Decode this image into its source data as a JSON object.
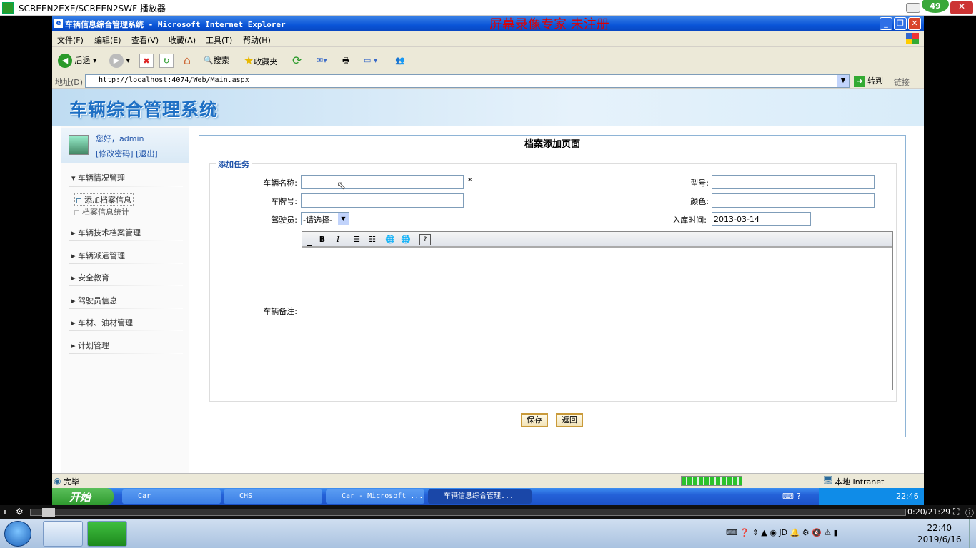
{
  "player": {
    "title": "SCREEN2EXE/SCREEN2SWF 播放器",
    "badge": "49",
    "time": "0:20/21:29"
  },
  "ie": {
    "title": "车辆信息综合管理系统 - Microsoft Internet Explorer",
    "watermark": "屏幕录像专家  未注册",
    "menu": [
      "文件(F)",
      "编辑(E)",
      "查看(V)",
      "收藏(A)",
      "工具(T)",
      "帮助(H)"
    ],
    "toolbar": {
      "back": "后退",
      "search": "搜索",
      "favorites": "收藏夹"
    },
    "address_label": "地址(D)",
    "address": "http://localhost:4074/Web/Main.aspx",
    "go": "转到",
    "links": "链接",
    "status": "完毕",
    "zone": "本地 Intranet"
  },
  "app": {
    "banner": "车辆综合管理系统",
    "user": {
      "greeting": "您好，admin",
      "links": "[修改密码] [退出]"
    },
    "nav": [
      {
        "label": "车辆情况管理",
        "expanded": true,
        "children": [
          "添加档案信息",
          "档案信息统计"
        ]
      },
      {
        "label": "车辆技术档案管理"
      },
      {
        "label": "车辆派遣管理"
      },
      {
        "label": "安全教育"
      },
      {
        "label": "驾驶员信息"
      },
      {
        "label": "车材、油材管理"
      },
      {
        "label": "计划管理"
      }
    ]
  },
  "form": {
    "heading": "档案添加页面",
    "legend": "添加任务",
    "labels": {
      "name": "车辆名称:",
      "model": "型号:",
      "plate": "车牌号:",
      "color": "颜色:",
      "driver": "驾驶员:",
      "date": "入库时间:",
      "notes": "车辆备注:"
    },
    "required_mark": "*",
    "driver_value": "-请选择-",
    "date_value": "2013-03-14",
    "save": "保存",
    "back": "返回"
  },
  "xp_taskbar": {
    "start": "开始",
    "items": [
      "Car",
      "CHS",
      "Car - Microsoft ...",
      "车辆信息综合管理..."
    ],
    "clock": "22:46"
  },
  "win7": {
    "time": "22:40",
    "date": "2019/6/16"
  }
}
